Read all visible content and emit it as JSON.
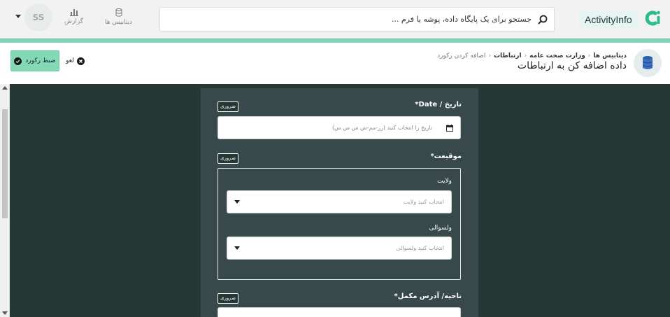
{
  "app": {
    "logo_text": "ActivityInfo",
    "brand_color": "#2bbd8e",
    "accent_strip_color": "#7fd1b9"
  },
  "header": {
    "search_placeholder": "جستجو برای یک پایگاه داده، پوشه یا فرم ...",
    "nav": [
      {
        "label": "دیتابیس ها",
        "icon": "database-icon"
      },
      {
        "label": "گزارش",
        "icon": "bar-chart-icon"
      }
    ],
    "avatar_initials": "SS"
  },
  "breadcrumb": {
    "items": [
      "دیتابیس ها",
      "وزارت صحت عامه",
      "ارتباطات",
      "اضافه کردن رکورد"
    ]
  },
  "page": {
    "title": "داده اضافه کن به ارتباطات"
  },
  "actions": {
    "save_label": "ضبط رکورد",
    "cancel_label": "لغو"
  },
  "form": {
    "required_badge": "ضروری",
    "fields": {
      "date": {
        "label": "تاریخ / Date*",
        "placeholder": "تاریخ را انتخاب کنید (رر-مم-س س س س)"
      },
      "location": {
        "label": "موقیعت*",
        "province": {
          "label": "ولایت",
          "placeholder": "انتخاب کنید ولایت"
        },
        "district": {
          "label": "ولسوالی",
          "placeholder": "انتخاب کنید ولسوالی"
        }
      },
      "address": {
        "label": "ناحیه/ آدرس مکمل*"
      }
    }
  }
}
